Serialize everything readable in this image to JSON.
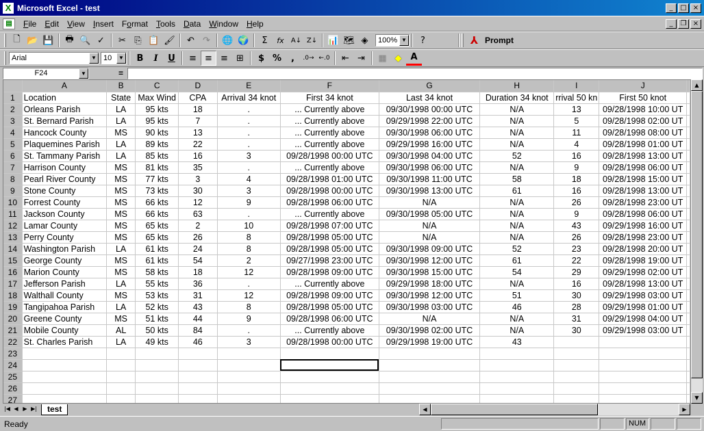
{
  "window": {
    "title": "Microsoft Excel - test",
    "app_icon": "X",
    "minimize": "_",
    "maximize": "□",
    "close": "×"
  },
  "menu": {
    "items": [
      {
        "prefix": "",
        "key": "F",
        "rest": "ile"
      },
      {
        "prefix": "",
        "key": "E",
        "rest": "dit"
      },
      {
        "prefix": "",
        "key": "V",
        "rest": "iew"
      },
      {
        "prefix": "",
        "key": "I",
        "rest": "nsert"
      },
      {
        "prefix": "F",
        "key": "o",
        "rest": "rmat"
      },
      {
        "prefix": "",
        "key": "T",
        "rest": "ools"
      },
      {
        "prefix": "",
        "key": "D",
        "rest": "ata"
      },
      {
        "prefix": "",
        "key": "W",
        "rest": "indow"
      },
      {
        "prefix": "",
        "key": "H",
        "rest": "elp"
      }
    ],
    "doc_minimize": "_",
    "doc_restore": "❐",
    "doc_close": "×"
  },
  "toolbar": {
    "zoom": "100%",
    "prompt_label": "Prompt",
    "icons": {
      "new": "🗋",
      "open": "📂",
      "save": "💾",
      "print": "🖶",
      "preview": "🔍",
      "spelling": "✓",
      "cut": "✂",
      "copy": "⎘",
      "paste": "📋",
      "format_painter": "🖌",
      "undo": "↶",
      "redo": "↷",
      "hyperlink": "🌐",
      "web": "🌍",
      "autosum": "Σ",
      "function": "fx",
      "sort_asc": "A↓",
      "sort_desc": "Z↓",
      "chart": "📊",
      "map": "🗺",
      "drawing": "◈",
      "help": "?"
    }
  },
  "format_toolbar": {
    "font": "Arial",
    "size": "10",
    "bold": "B",
    "italic": "I",
    "underline": "U",
    "align_left": "≡",
    "align_center": "≡",
    "align_right": "≡",
    "merge": "⊞",
    "currency": "$",
    "percent": "%",
    "comma": ",",
    "inc_decimal": ".0→",
    "dec_decimal": "←.0",
    "dec_indent": "⇤",
    "inc_indent": "⇥",
    "borders": "▦",
    "fill": "◆",
    "font_color": "A"
  },
  "formula_bar": {
    "cell_ref": "F24",
    "equals": "=",
    "value": ""
  },
  "sheet": {
    "columns": [
      "A",
      "B",
      "C",
      "D",
      "E",
      "F",
      "G",
      "H",
      "I",
      "J"
    ],
    "header_row": [
      "Location",
      "State",
      "Max Wind",
      "CPA",
      "Arrival 34 knot",
      "First 34 knot",
      "Last 34 knot",
      "Duration 34 knot",
      "rrival 50 kn",
      "First 50 knot"
    ],
    "rows": [
      [
        "Orleans Parish",
        "LA",
        "95 kts",
        "18",
        ".",
        "... Currently above",
        "09/30/1998 00:00 UTC",
        "N/A",
        "13",
        "09/28/1998 10:00 UT"
      ],
      [
        "St. Bernard Parish",
        "LA",
        "95 kts",
        "7",
        ".",
        "... Currently above",
        "09/29/1998 22:00 UTC",
        "N/A",
        "5",
        "09/28/1998 02:00 UT"
      ],
      [
        "Hancock County",
        "MS",
        "90 kts",
        "13",
        ".",
        "... Currently above",
        "09/30/1998 06:00 UTC",
        "N/A",
        "11",
        "09/28/1998 08:00 UT"
      ],
      [
        "Plaquemines Parish",
        "LA",
        "89 kts",
        "22",
        ".",
        "... Currently above",
        "09/29/1998 16:00 UTC",
        "N/A",
        "4",
        "09/28/1998 01:00 UT"
      ],
      [
        "St. Tammany Parish",
        "LA",
        "85 kts",
        "16",
        "3",
        "09/28/1998 00:00 UTC",
        "09/30/1998 04:00 UTC",
        "52",
        "16",
        "09/28/1998 13:00 UT"
      ],
      [
        "Harrison County",
        "MS",
        "81 kts",
        "35",
        ".",
        "... Currently above",
        "09/30/1998 06:00 UTC",
        "N/A",
        "9",
        "09/28/1998 06:00 UT"
      ],
      [
        "Pearl River County",
        "MS",
        "77 kts",
        "3",
        "4",
        "09/28/1998 01:00 UTC",
        "09/30/1998 11:00 UTC",
        "58",
        "18",
        "09/28/1998 15:00 UT"
      ],
      [
        "Stone County",
        "MS",
        "73 kts",
        "30",
        "3",
        "09/28/1998 00:00 UTC",
        "09/30/1998 13:00 UTC",
        "61",
        "16",
        "09/28/1998 13:00 UT"
      ],
      [
        "Forrest County",
        "MS",
        "66 kts",
        "12",
        "9",
        "09/28/1998 06:00 UTC",
        "N/A",
        "N/A",
        "26",
        "09/28/1998 23:00 UT"
      ],
      [
        "Jackson County",
        "MS",
        "66 kts",
        "63",
        ".",
        "... Currently above",
        "09/30/1998 05:00 UTC",
        "N/A",
        "9",
        "09/28/1998 06:00 UT"
      ],
      [
        "Lamar County",
        "MS",
        "65 kts",
        "2",
        "10",
        "09/28/1998 07:00 UTC",
        "N/A",
        "N/A",
        "43",
        "09/29/1998 16:00 UT"
      ],
      [
        "Perry County",
        "MS",
        "65 kts",
        "26",
        "8",
        "09/28/1998 05:00 UTC",
        "N/A",
        "N/A",
        "26",
        "09/28/1998 23:00 UT"
      ],
      [
        "Washington Parish",
        "LA",
        "61 kts",
        "24",
        "8",
        "09/28/1998 05:00 UTC",
        "09/30/1998 09:00 UTC",
        "52",
        "23",
        "09/28/1998 20:00 UT"
      ],
      [
        "George County",
        "MS",
        "61 kts",
        "54",
        "2",
        "09/27/1998 23:00 UTC",
        "09/30/1998 12:00 UTC",
        "61",
        "22",
        "09/28/1998 19:00 UT"
      ],
      [
        "Marion County",
        "MS",
        "58 kts",
        "18",
        "12",
        "09/28/1998 09:00 UTC",
        "09/30/1998 15:00 UTC",
        "54",
        "29",
        "09/29/1998 02:00 UT"
      ],
      [
        "Jefferson Parish",
        "LA",
        "55 kts",
        "36",
        ".",
        "... Currently above",
        "09/29/1998 18:00 UTC",
        "N/A",
        "16",
        "09/28/1998 13:00 UT"
      ],
      [
        "Walthall County",
        "MS",
        "53 kts",
        "31",
        "12",
        "09/28/1998 09:00 UTC",
        "09/30/1998 12:00 UTC",
        "51",
        "30",
        "09/29/1998 03:00 UT"
      ],
      [
        "Tangipahoa Parish",
        "LA",
        "52 kts",
        "43",
        "8",
        "09/28/1998 05:00 UTC",
        "09/30/1998 03:00 UTC",
        "46",
        "28",
        "09/29/1998 01:00 UT"
      ],
      [
        "Greene County",
        "MS",
        "51 kts",
        "44",
        "9",
        "09/28/1998 06:00 UTC",
        "N/A",
        "N/A",
        "31",
        "09/29/1998 04:00 UT"
      ],
      [
        "Mobile County",
        "AL",
        "50 kts",
        "84",
        ".",
        "... Currently above",
        "09/30/1998 02:00 UTC",
        "N/A",
        "30",
        "09/29/1998 03:00 UT"
      ],
      [
        "St. Charles Parish",
        "LA",
        "49 kts",
        "46",
        "3",
        "09/28/1998 00:00 UTC",
        "09/29/1998 19:00 UTC",
        "43",
        "",
        ""
      ]
    ],
    "empty_rows": [
      23,
      24,
      25,
      26,
      27
    ],
    "active_row": 24,
    "active_col": "F"
  },
  "tabs": {
    "sheet_name": "test"
  },
  "status": {
    "text": "Ready",
    "num": "NUM"
  }
}
